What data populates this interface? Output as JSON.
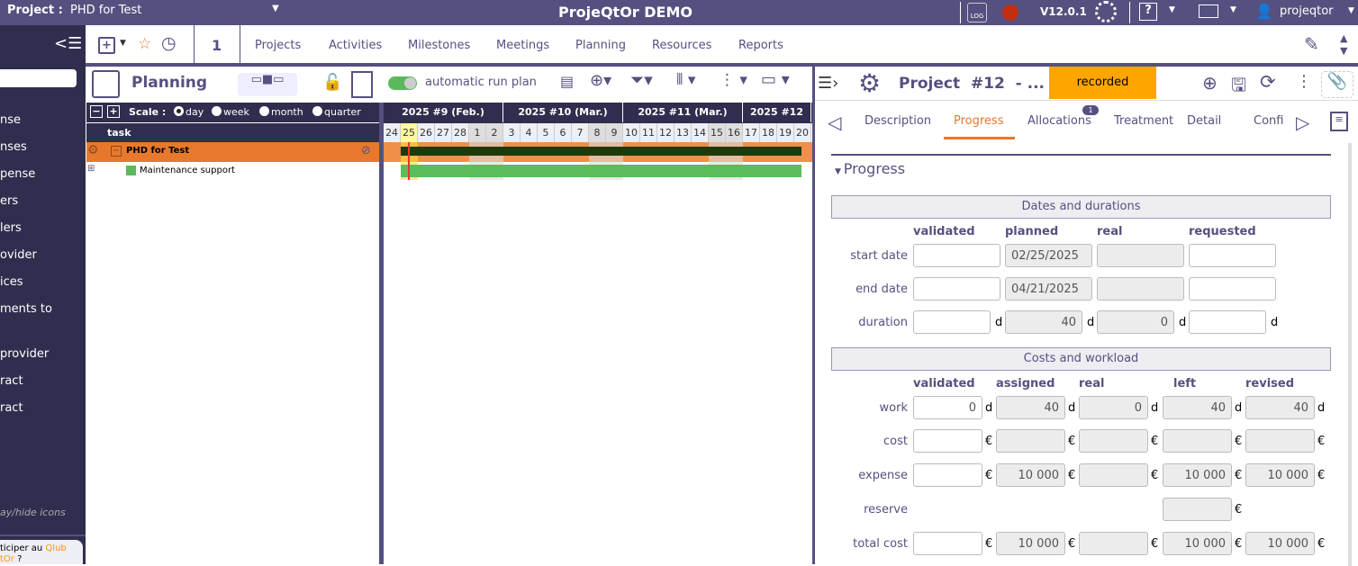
{
  "topbar": {
    "project_label": "Project :",
    "project_name": "PHD for Test",
    "app_title": "ProjeQtOr DEMO",
    "log": "LOG",
    "version": "V12.0.1",
    "help": "?",
    "user": "projeqtor"
  },
  "sidebar": {
    "items": [
      "nse",
      "nses",
      "pense",
      "ers",
      "lers",
      "ovider",
      "ices",
      "ments to",
      "provider",
      "ract",
      "ract"
    ],
    "toggle_icons": "ay/hide icons",
    "club_text": "ticiper au ",
    "club_link": "Qlub",
    "club_line2": "tOr",
    "club_q": " ?"
  },
  "toolbar": {
    "count": "1",
    "menus": [
      "Projects",
      "Activities",
      "Milestones",
      "Meetings",
      "Planning",
      "Resources",
      "Reports"
    ]
  },
  "planning": {
    "title": "Planning",
    "auto_run": "automatic run plan",
    "auto_run_on": true,
    "scale_label": "Scale :",
    "scales": [
      "day",
      "week",
      "month",
      "quarter"
    ],
    "scale_selected": "day",
    "task_header": "task",
    "tasks": [
      {
        "name": "PHD for Test",
        "type": "project"
      },
      {
        "name": "Maintenance support",
        "type": "activity",
        "color": "#5cb85c"
      }
    ]
  },
  "gantt": {
    "weeks": [
      {
        "label": "2025 #9 (Feb.)",
        "days": 7
      },
      {
        "label": "2025 #10 (Mar.)",
        "days": 7
      },
      {
        "label": "2025 #11 (Mar.)",
        "days": 7
      },
      {
        "label": "2025 #12",
        "days": 4
      }
    ],
    "days": [
      "24",
      "25",
      "26",
      "27",
      "28",
      "1",
      "2",
      "3",
      "4",
      "5",
      "6",
      "7",
      "8",
      "9",
      "10",
      "11",
      "12",
      "13",
      "14",
      "15",
      "16",
      "17",
      "18",
      "19",
      "20"
    ],
    "weekend": [
      5,
      6,
      12,
      13,
      19,
      20
    ],
    "today_index": 1
  },
  "detail": {
    "title": "Project  #12  - ...",
    "status": "recorded",
    "status_color": "#ffa500",
    "tabs": [
      "Description",
      "Progress",
      "Allocations",
      "Treatment",
      "Detail",
      "Confi"
    ],
    "active_tab": "Progress",
    "allocations_badge": "1",
    "section": "Progress",
    "dates": {
      "header": "Dates and durations",
      "cols": [
        "validated",
        "planned",
        "real",
        "requested"
      ],
      "rows": [
        {
          "label": "start date",
          "values": [
            "",
            "02/25/2025",
            "",
            ""
          ]
        },
        {
          "label": "end date",
          "values": [
            "",
            "04/21/2025",
            "",
            ""
          ]
        },
        {
          "label": "duration",
          "values": [
            "",
            "40",
            "0",
            ""
          ],
          "unit": "d"
        }
      ]
    },
    "costs": {
      "header": "Costs and workload",
      "cols": [
        "validated",
        "assigned",
        "real",
        "left",
        "revised"
      ],
      "rows": [
        {
          "label": "work",
          "values": [
            "0",
            "40",
            "0",
            "40",
            "40"
          ],
          "unit": "d"
        },
        {
          "label": "cost",
          "values": [
            "",
            "",
            "",
            "",
            ""
          ],
          "unit": "€"
        },
        {
          "label": "expense",
          "values": [
            "",
            "10 000",
            "",
            "10 000",
            "10 000"
          ],
          "unit": "€"
        },
        {
          "label": "reserve",
          "values": [
            null,
            null,
            null,
            "",
            null
          ],
          "unit": "€"
        },
        {
          "label": "total cost",
          "values": [
            "",
            "10 000",
            "",
            "10 000",
            "10 000"
          ],
          "unit": "€"
        }
      ]
    }
  }
}
